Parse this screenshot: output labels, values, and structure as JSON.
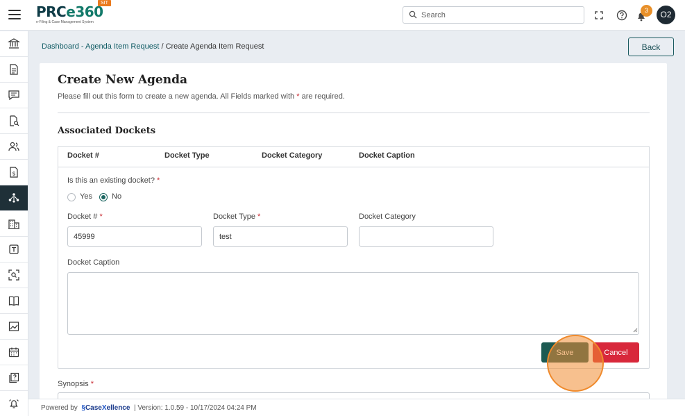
{
  "header": {
    "logo_text_main": "PRC",
    "logo_text_e": "e360",
    "logo_subtitle": "e-Filing & Case Management System",
    "env_badge": "SIT",
    "search_placeholder": "Search",
    "notification_count": "3",
    "avatar_initials": "O2"
  },
  "sidebar": {
    "items": [
      {
        "icon": "bank-icon"
      },
      {
        "icon": "document-icon"
      },
      {
        "icon": "chat-icon"
      },
      {
        "icon": "document-search-icon"
      },
      {
        "icon": "users-icon"
      },
      {
        "icon": "dollar-document-icon"
      },
      {
        "icon": "agenda-network-icon",
        "active": true
      },
      {
        "icon": "building-icon"
      },
      {
        "icon": "text-template-icon"
      },
      {
        "icon": "scan-search-icon"
      },
      {
        "icon": "book-icon"
      },
      {
        "icon": "image-chart-icon"
      },
      {
        "icon": "calendar-icon"
      },
      {
        "icon": "help-book-icon"
      },
      {
        "icon": "alarm-bell-icon"
      }
    ]
  },
  "breadcrumb": {
    "link": "Dashboard - Agenda Item Request",
    "separator": " / ",
    "current": "Create Agenda Item Request"
  },
  "back_button": "Back",
  "form": {
    "title": "Create New Agenda",
    "description_prefix": "Please fill out this form to create a new agenda. All Fields marked with ",
    "description_star": "*",
    "description_suffix": " are required.",
    "section_title": "Associated Dockets",
    "table_headers": [
      "Docket #",
      "Docket Type",
      "Docket Category",
      "Docket Caption"
    ],
    "existing_question": "Is this an existing docket?",
    "required_marker": "*",
    "radio_yes": "Yes",
    "radio_no": "No",
    "selected_option": "No",
    "docket_number_label": "Docket #",
    "docket_number_value": "45999",
    "docket_type_label": "Docket Type",
    "docket_type_value": "test",
    "docket_category_label": "Docket Category",
    "docket_category_value": "",
    "docket_caption_label": "Docket Caption",
    "docket_caption_value": "",
    "save_label": "Save",
    "cancel_label": "Cancel",
    "synopsis_label": "Synopsis"
  },
  "footer": {
    "powered_by": "Powered by",
    "brand_case": "Case",
    "brand_x": "X",
    "brand_rest": "ellence",
    "version": "|  Version: 1.0.59 - 10/17/2024 04:24 PM"
  },
  "colors": {
    "primary": "#1d5a52",
    "danger": "#d8283b",
    "accent": "#e8902a",
    "sidebar_active": "#1f3038"
  }
}
